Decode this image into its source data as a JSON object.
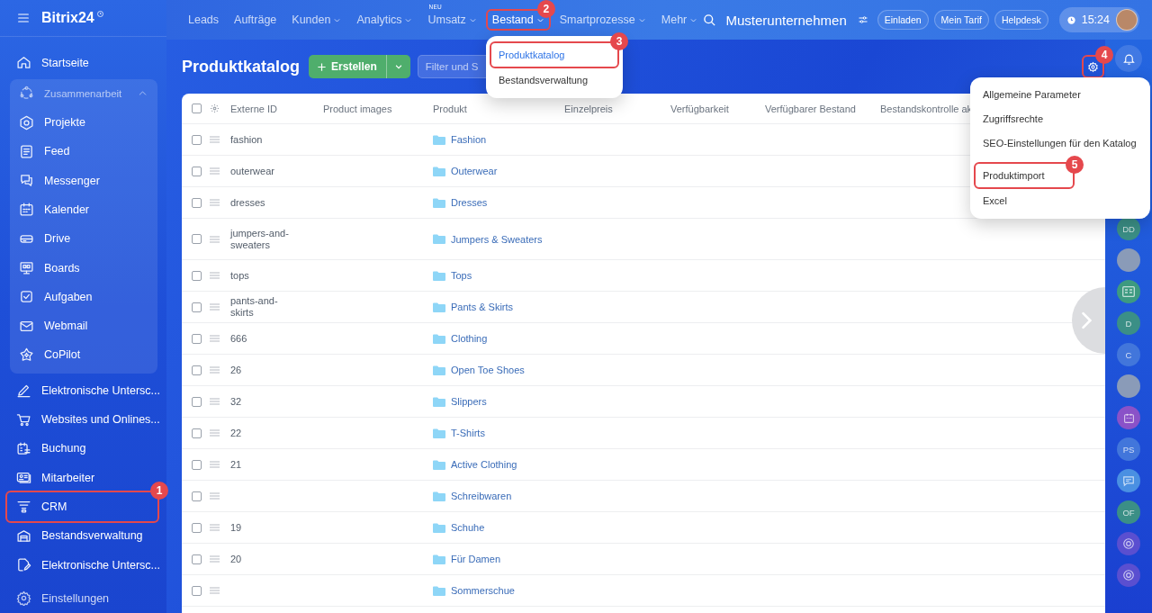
{
  "sidebar": {
    "logo": "Bitrix24",
    "items": [
      {
        "kind": "item",
        "label": "Startseite"
      },
      {
        "kind": "group",
        "label": "Zusammenarbeit",
        "expanded": true,
        "children": [
          {
            "kind": "item",
            "label": "Projekte"
          },
          {
            "kind": "item",
            "label": "Feed"
          },
          {
            "kind": "item",
            "label": "Messenger"
          },
          {
            "kind": "item",
            "label": "Kalender"
          },
          {
            "kind": "item",
            "label": "Drive"
          },
          {
            "kind": "item",
            "label": "Boards"
          },
          {
            "kind": "item",
            "label": "Aufgaben"
          },
          {
            "kind": "item",
            "label": "Webmail"
          },
          {
            "kind": "item",
            "label": "CoPilot"
          }
        ]
      },
      {
        "kind": "item",
        "label": "Elektronische Untersc..."
      },
      {
        "kind": "item",
        "label": "Websites und Onlines..."
      },
      {
        "kind": "item",
        "label": "Buchung"
      },
      {
        "kind": "item",
        "label": "Mitarbeiter"
      },
      {
        "kind": "item",
        "label": "CRM",
        "callout": "1"
      },
      {
        "kind": "item",
        "label": "Bestandsverwaltung"
      },
      {
        "kind": "item",
        "label": "Elektronische Untersc..."
      },
      {
        "kind": "footer",
        "label": "Einstellungen"
      }
    ]
  },
  "top_nav": {
    "items": [
      {
        "label": "Leads",
        "dropdown": false,
        "selected": false
      },
      {
        "label": "Aufträge",
        "dropdown": false,
        "selected": false
      },
      {
        "label": "Kunden",
        "dropdown": true,
        "selected": false
      },
      {
        "label": "Analytics",
        "dropdown": true,
        "selected": false
      },
      {
        "label": "Umsatz",
        "dropdown": true,
        "selected": false,
        "badge": "NEU"
      },
      {
        "label": "Bestand",
        "dropdown": true,
        "selected": true,
        "callout": "2"
      },
      {
        "label": "Smartprozesse",
        "dropdown": true,
        "selected": false
      },
      {
        "label": "Mehr",
        "dropdown": true,
        "selected": false
      }
    ],
    "company": "Musterunternehmen",
    "buttons": [
      "Einladen",
      "Mein Tarif",
      "Helpdesk"
    ],
    "time": "15:24"
  },
  "bestand_menu": {
    "items": [
      {
        "label": "Produktkatalog",
        "selected": true,
        "callout": "3"
      },
      {
        "label": "Bestandsverwaltung",
        "selected": false
      }
    ]
  },
  "page": {
    "title": "Produktkatalog",
    "create_button": "Erstellen",
    "filter": {
      "placeholder": "Filter und S"
    },
    "settings_callout": "4"
  },
  "settings_menu": {
    "items": [
      {
        "label": "Allgemeine Parameter"
      },
      {
        "label": "Zugriffsrechte"
      },
      {
        "label": "SEO-Einstellungen für den Katalog"
      },
      {
        "label": "Produktimport",
        "callout": "5"
      },
      {
        "label": "Excel"
      }
    ]
  },
  "table": {
    "select_all": {
      "checked": false
    },
    "columns": [
      "Externe ID",
      "Product images",
      "Produkt",
      "Einzelpreis",
      "Verfügbarkeit",
      "Verfügbarer Bestand",
      "Bestandskontrolle ak"
    ],
    "rows": [
      {
        "checked": false,
        "external_id": "fashion",
        "product": "Fashion"
      },
      {
        "checked": false,
        "external_id": "outerwear",
        "product": "Outerwear"
      },
      {
        "checked": false,
        "external_id": "dresses",
        "product": "Dresses"
      },
      {
        "checked": false,
        "external_id": "jumpers-and-sweaters",
        "product": "Jumpers & Sweaters"
      },
      {
        "checked": false,
        "external_id": "tops",
        "product": "Tops"
      },
      {
        "checked": false,
        "external_id": "pants-and-skirts",
        "product": "Pants & Skirts"
      },
      {
        "checked": false,
        "external_id": "666",
        "product": "Clothing"
      },
      {
        "checked": false,
        "external_id": "26",
        "product": "Open Toe Shoes"
      },
      {
        "checked": false,
        "external_id": "32",
        "product": "Slippers"
      },
      {
        "checked": false,
        "external_id": "22",
        "product": "T-Shirts"
      },
      {
        "checked": false,
        "external_id": "21",
        "product": "Active Clothing"
      },
      {
        "checked": false,
        "external_id": "",
        "product": "Schreibwaren"
      },
      {
        "checked": false,
        "external_id": "19",
        "product": "Schuhe"
      },
      {
        "checked": false,
        "external_id": "20",
        "product": "Für Damen"
      },
      {
        "checked": false,
        "external_id": "",
        "product": "Sommerschue"
      }
    ]
  },
  "right_rail": {
    "items": [
      {
        "kind": "initials",
        "text": "DD",
        "color": "#3b8f86"
      },
      {
        "kind": "photo"
      },
      {
        "kind": "card",
        "color": "#3d9a80"
      },
      {
        "kind": "initials",
        "text": "D",
        "color": "#3b8f86"
      },
      {
        "kind": "initials",
        "text": "C",
        "color": "#4276db"
      },
      {
        "kind": "photo"
      },
      {
        "kind": "calendar",
        "color": "#8a52c8"
      },
      {
        "kind": "initials",
        "text": "PS",
        "color": "#4276db"
      },
      {
        "kind": "chat",
        "color": "#4a90e2"
      },
      {
        "kind": "initials",
        "text": "OF",
        "color": "#3b8f86"
      },
      {
        "kind": "target",
        "color": "#5a4fd0"
      },
      {
        "kind": "target",
        "color": "#5a4fd0"
      }
    ]
  }
}
